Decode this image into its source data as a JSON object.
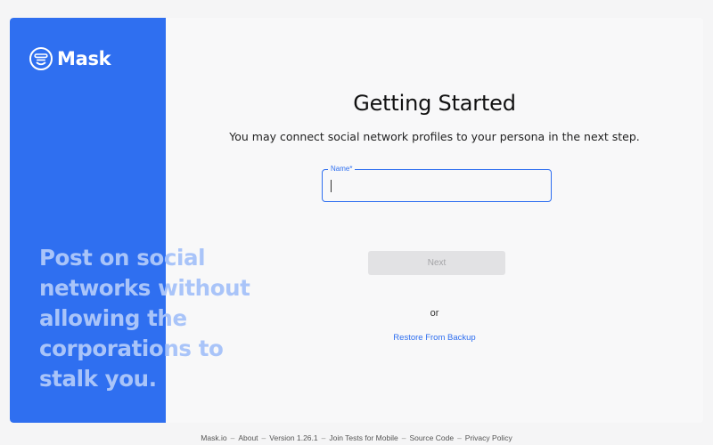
{
  "brand": {
    "name": "Mask",
    "color": "#2f6ff0",
    "logo_icon": "mask-face-icon"
  },
  "sidebar": {
    "tagline": "Post on social networks without allowing the corporations to stalk you."
  },
  "main": {
    "title": "Getting Started",
    "subtitle": "You may connect social network profiles to your persona in the next step.",
    "name_field": {
      "label": "Name",
      "required_mark": "*",
      "value": "",
      "focused": true
    },
    "next_button": {
      "label": "Next",
      "disabled": true
    },
    "or_text": "or",
    "restore_link": "Restore From Backup"
  },
  "footer": {
    "links": [
      "Mask.io",
      "About",
      "Version 1.26.1",
      "Join Tests for Mobile",
      "Source Code",
      "Privacy Policy"
    ],
    "separator": "–"
  }
}
